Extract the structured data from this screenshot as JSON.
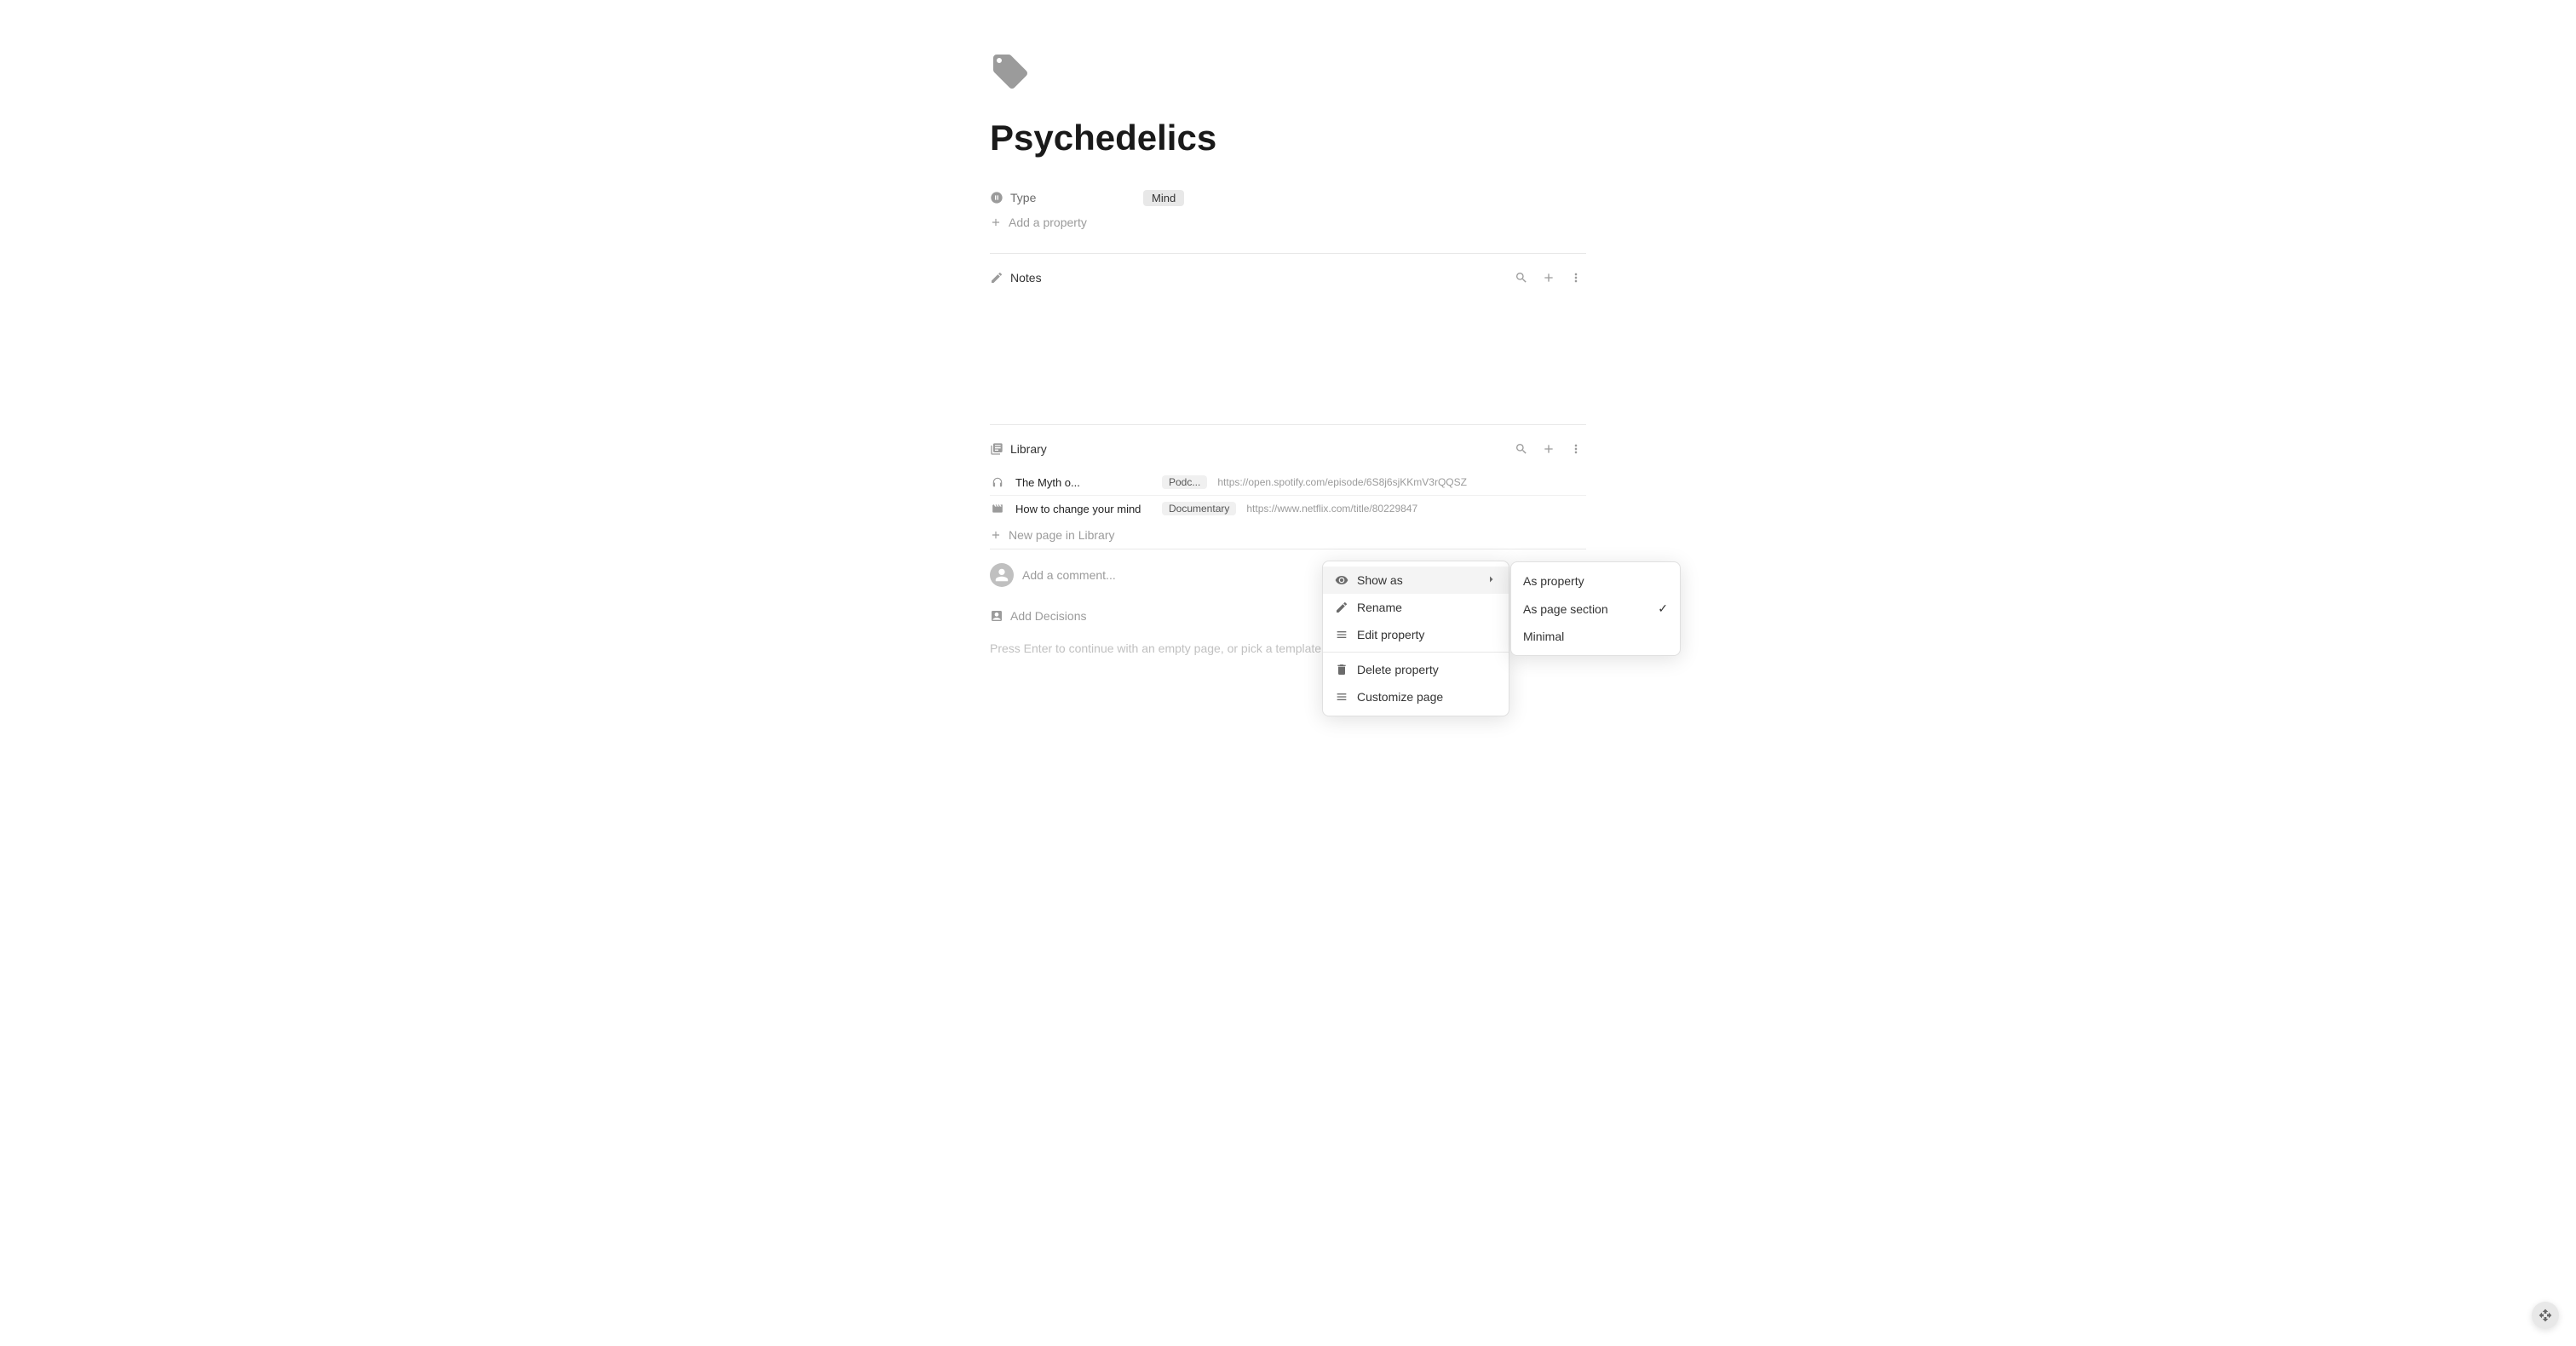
{
  "page": {
    "title": "Psychedelics",
    "icon_label": "tag-icon"
  },
  "properties": {
    "type_label": "Type",
    "type_value": "Mind",
    "add_property_label": "Add a property"
  },
  "notes_section": {
    "title": "Notes",
    "search_label": "Search",
    "add_label": "Add",
    "more_label": "More"
  },
  "context_menu": {
    "show_as_label": "Show as",
    "rename_label": "Rename",
    "edit_property_label": "Edit property",
    "delete_property_label": "Delete property",
    "customize_page_label": "Customize page"
  },
  "submenu": {
    "as_property_label": "As property",
    "as_page_section_label": "As page section",
    "minimal_label": "Minimal",
    "selected": "As page section"
  },
  "library_section": {
    "title": "Library"
  },
  "library_items": [
    {
      "name": "The Myth o...",
      "tag": "Podc...",
      "url": "https://open.spotify.com/episode/6S8j6sjKKmV3rQQSZ"
    },
    {
      "name": "How to change your mind",
      "tag": "Documentary",
      "url": "https://www.netflix.com/title/80229847"
    }
  ],
  "new_page_label": "New page in Library",
  "comment_placeholder": "Add a comment...",
  "decisions_label": "Add Decisions",
  "bottom_hint": "Press Enter to continue with an empty page, or pick a template (↑↓ to select)"
}
